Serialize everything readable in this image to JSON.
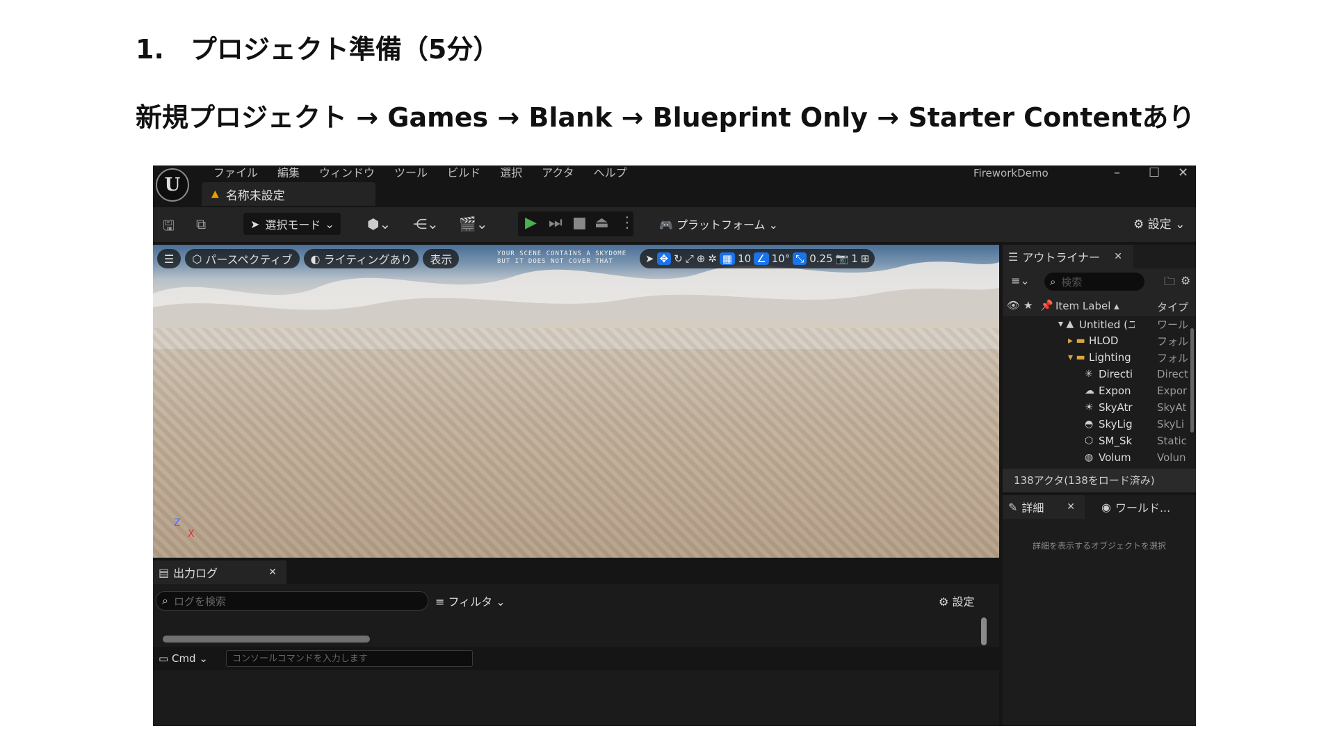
{
  "heading1": "1.　プロジェクト準備（5分）",
  "heading2": "新規プロジェクト → Games → Blank → Blueprint Only → Starter Contentあり",
  "editor": {
    "menu": [
      "ファイル",
      "編集",
      "ウィンドウ",
      "ツール",
      "ビルド",
      "選択",
      "アクタ",
      "ヘルプ"
    ],
    "doc_tab": "名称未設定",
    "app_title": "FireworkDemo",
    "toolbar": {
      "mode": "選択モード",
      "platform": "プラットフォーム",
      "settings": "設定"
    },
    "viewport": {
      "perspective": "パースペクティブ",
      "lighting": "ライティングあり",
      "show": "表示",
      "warning_line1": "YOUR SCENE CONTAINS A SKYDOME",
      "warning_line2": "BUT IT DOES NOT COVER THAT",
      "grid_snap": "10",
      "rot_snap": "10°",
      "scale_snap": "0.25",
      "camera_speed": "1",
      "axis_z": "Z",
      "axis_x": "X"
    },
    "outlog": {
      "tab": "出力ログ",
      "search_placeholder": "ログを検索",
      "filter": "フィルタ",
      "settings": "設定",
      "cmd": "Cmd",
      "cmd_placeholder": "コンソールコマンドを入力します"
    },
    "outliner": {
      "tab": "アウトライナー",
      "search_placeholder": "検索",
      "col_label": "Item Label ▴",
      "col_type": "タイプ",
      "rows": [
        {
          "name": "Untitled (ユ",
          "type": "ワール"
        },
        {
          "name": "HLOD",
          "type": "フォル"
        },
        {
          "name": "Lighting",
          "type": "フォル"
        },
        {
          "name": "Directi",
          "type": "Direct"
        },
        {
          "name": "Expon",
          "type": "Expor"
        },
        {
          "name": "SkyAtr",
          "type": "SkyAt"
        },
        {
          "name": "SkyLig",
          "type": "SkyLi"
        },
        {
          "name": "SM_Sk",
          "type": "Static"
        },
        {
          "name": "Volum",
          "type": "Volun"
        }
      ],
      "footer": "138アクタ(138をロード済み)"
    },
    "details": {
      "tab": "詳細",
      "world_tab": "ワールド...",
      "empty_message": "詳細を表示するオブジェクトを選択"
    }
  }
}
